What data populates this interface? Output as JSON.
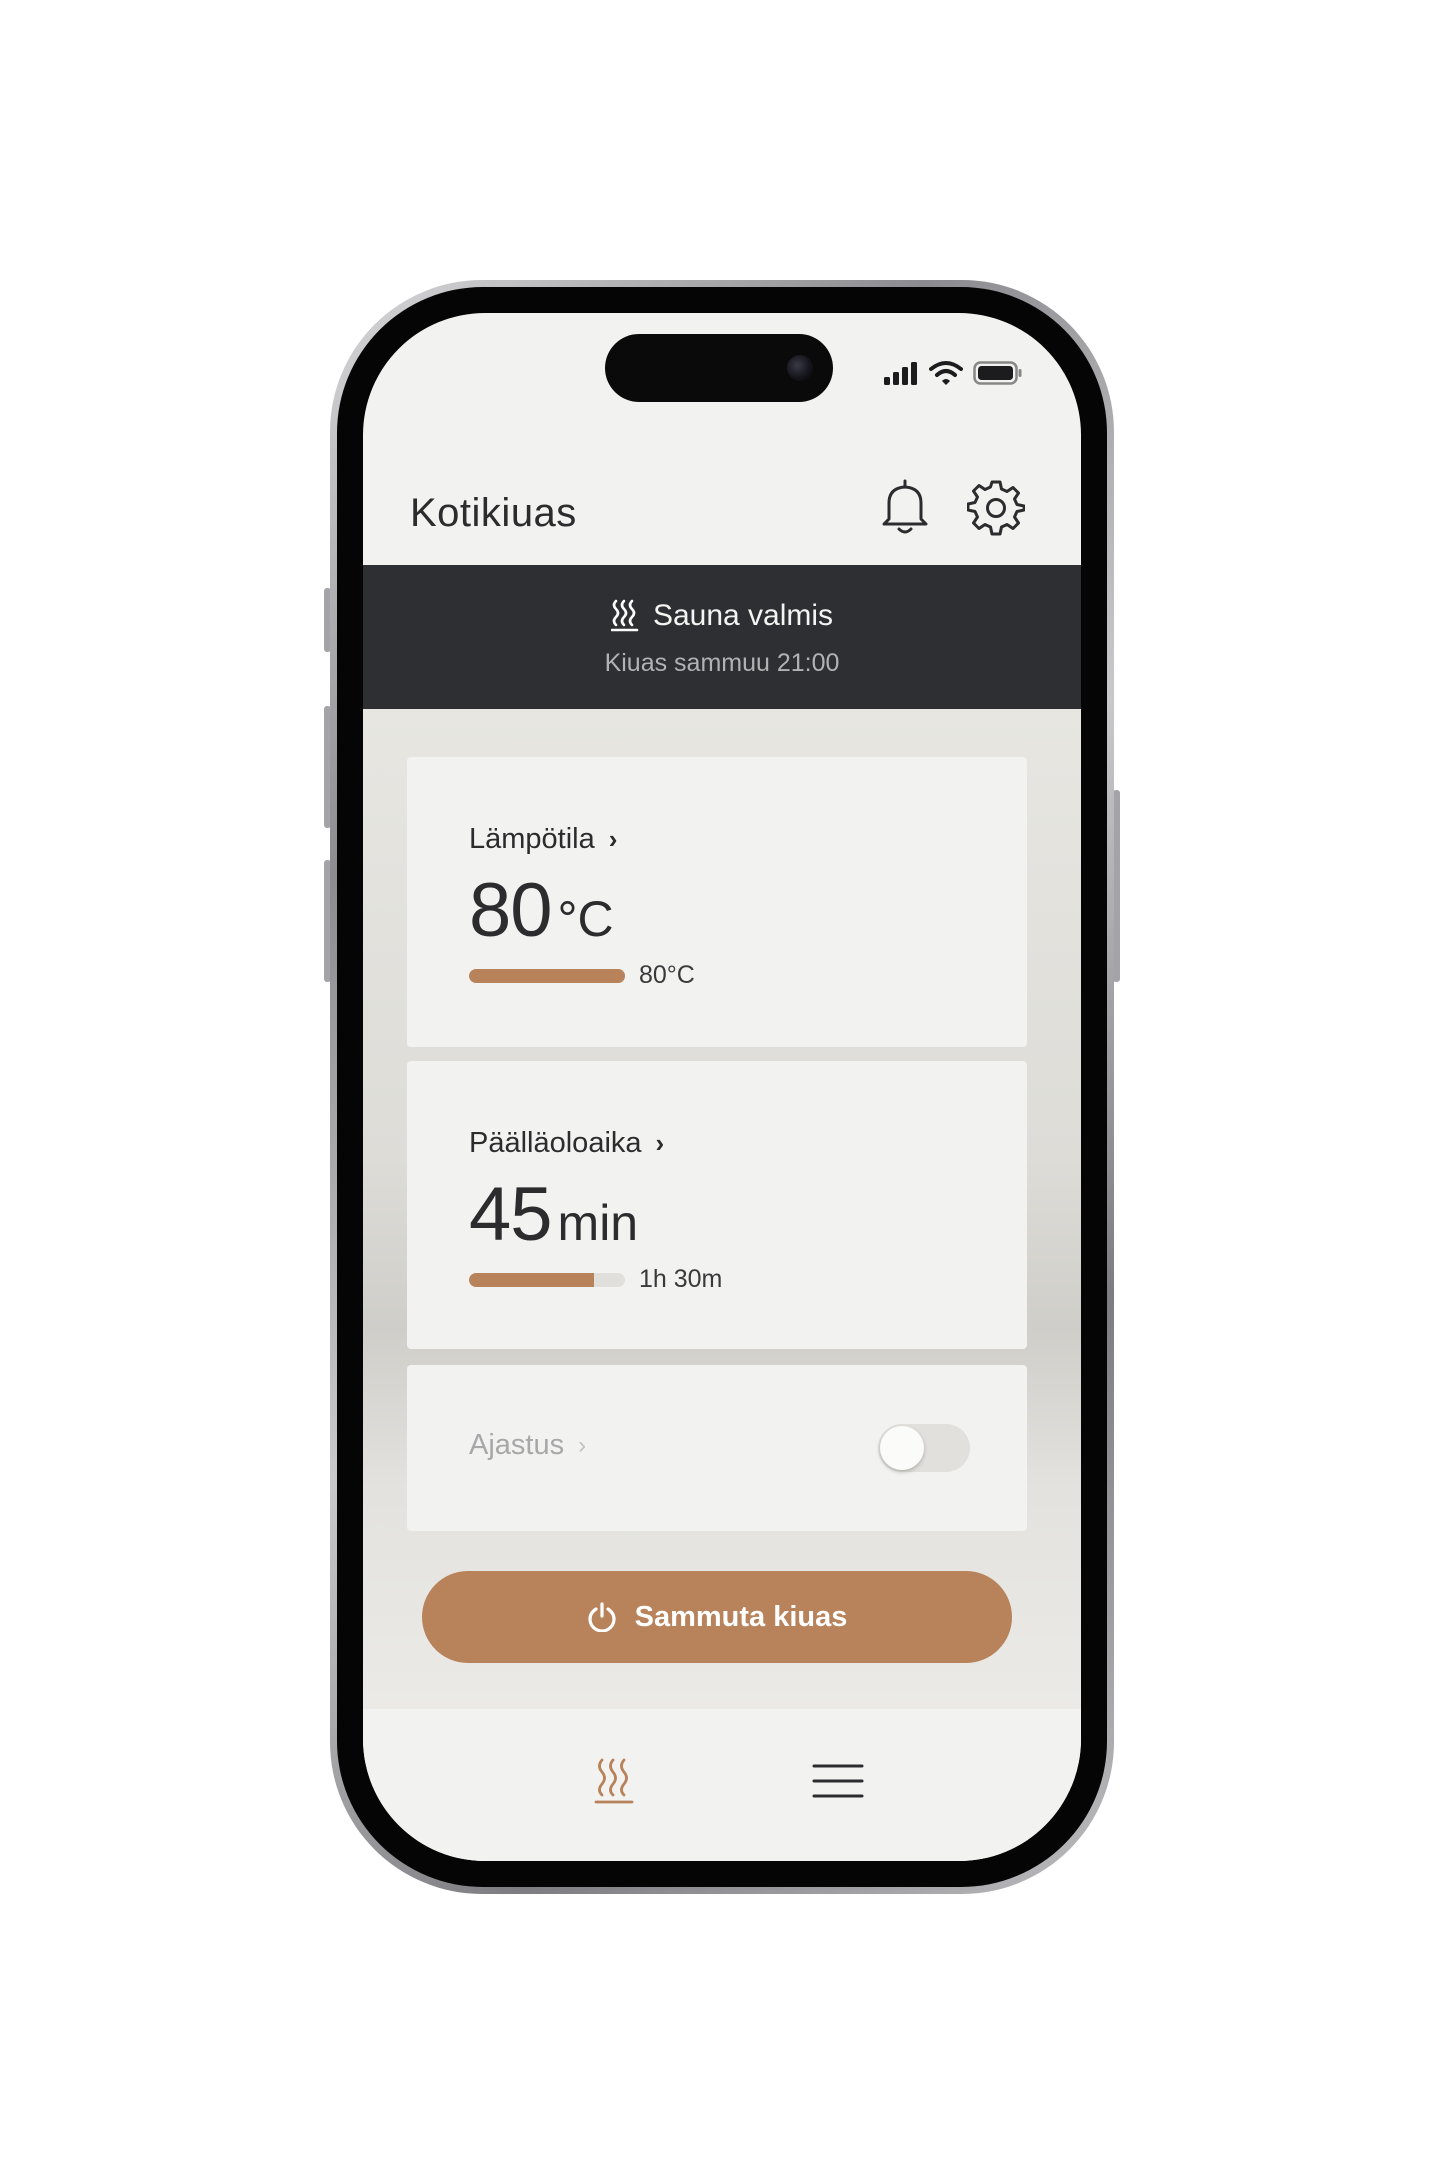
{
  "app": {
    "title": "Kotikiuas"
  },
  "status_bar": {
    "icons": [
      "signal-icon",
      "wifi-icon",
      "battery-icon"
    ]
  },
  "header": {
    "icons": [
      "bell-icon",
      "gear-icon"
    ]
  },
  "banner": {
    "icon": "sauna-heat-icon",
    "title": "Sauna valmis",
    "subtitle": "Kiuas sammuu 21:00"
  },
  "temperature_card": {
    "label": "Lämpötila",
    "value": "80",
    "unit": "°C",
    "target_label": "80°C",
    "progress": 1.0
  },
  "runtime_card": {
    "label": "Päälläoloaika",
    "value": "45",
    "unit": "min",
    "total_label": "1h 30m",
    "progress": 0.8
  },
  "timer_card": {
    "label": "Ajastus",
    "enabled": false
  },
  "power_button": {
    "label": "Sammuta kiuas",
    "icon": "power-icon"
  },
  "bottom_nav": {
    "items": [
      {
        "icon": "sauna-heat-icon",
        "active": true
      },
      {
        "icon": "menu-icon",
        "active": false
      }
    ]
  },
  "colors": {
    "accent": "#b8825a",
    "banner_bg": "#2e2f33",
    "surface": "#f2f2f0",
    "text": "#2c2c2e"
  }
}
